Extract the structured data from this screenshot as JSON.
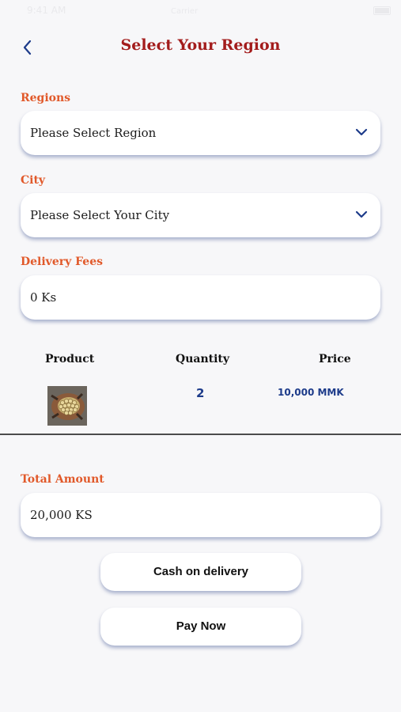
{
  "status_bar": {
    "time": "9:41 AM",
    "carrier": "Carrier"
  },
  "header": {
    "title": "Select Your Region",
    "back_icon": "chevron-left-icon"
  },
  "regions": {
    "label": "Regions",
    "placeholder": "Please Select Region",
    "icon": "chevron-down-icon"
  },
  "city": {
    "label": "City",
    "placeholder": "Please Select Your City",
    "icon": "chevron-down-icon"
  },
  "delivery_fees": {
    "label": "Delivery Fees",
    "value": "0 Ks"
  },
  "table": {
    "headers": [
      "Product",
      "Quantity",
      "Price"
    ],
    "rows": [
      {
        "image": "product-thumbnail",
        "quantity": "2",
        "price": "10,000 MMK"
      }
    ]
  },
  "total": {
    "label": "Total Amount",
    "value": "20,000 KS"
  },
  "actions": {
    "cash_on_delivery": "Cash on delivery",
    "pay_now": "Pay Now"
  },
  "colors": {
    "title": "#a31c1c",
    "label": "#e1592a",
    "accent": "#1d3b8a",
    "background": "#f7f7f9"
  }
}
